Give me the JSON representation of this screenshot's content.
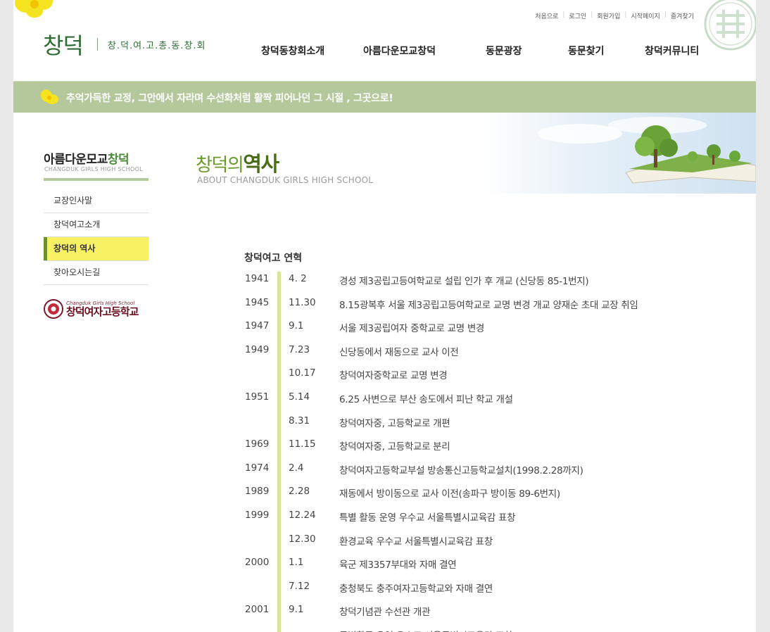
{
  "utility": [
    "처음으로",
    "로그인",
    "회원가입",
    "시작페이지",
    "즐겨찾기"
  ],
  "logo": {
    "main": "창덕",
    "sub": "창.덕.여.고.총.동.창.회"
  },
  "gnb": [
    "창덕동창회소개",
    "아름다운모교창덕",
    "동문광장",
    "동문찾기",
    "창덕커뮤니티"
  ],
  "slogan": "추억가득한 교정, 그안에서 자라며 수선화처럼 활짝 피어나던 그 시절 , 그곳으로!",
  "sidebar": {
    "title_a": "아름다운모교",
    "title_b": "창덕",
    "subtitle": "CHANGDUK GIRLS HIGH SCHOOL",
    "items": [
      {
        "label": "교장인사말",
        "active": false
      },
      {
        "label": "창덕여고소개",
        "active": false
      },
      {
        "label": "창덕의 역사",
        "active": true
      },
      {
        "label": "찾아오시는길",
        "active": false
      }
    ],
    "school_logo": {
      "en": "Changduk Girls High School",
      "ko": "창덕여자고등학교"
    }
  },
  "page": {
    "title_a": "창덕의",
    "title_b": "역사",
    "subtitle": "ABOUT CHANGDUK GIRLS HIGH SCHOOL"
  },
  "history": {
    "title": "창덕여고 연혁",
    "rows": [
      {
        "year": "1941",
        "date": "4. 2",
        "text": "경성 제3공립고등여학교로 설립 인가 후 개교 (신당동 85-1번지)"
      },
      {
        "year": "1945",
        "date": "11.30",
        "text": "8.15광복후 서울 제3공립고등여학교로 교명 변경 개교 양재순 초대 교장 취임"
      },
      {
        "year": "1947",
        "date": "9.1",
        "text": "서울 제3공립여자 중학교로 교명 변경"
      },
      {
        "year": "1949",
        "date": "7.23",
        "text": "신당동에서 재동으로 교사 이전"
      },
      {
        "year": "",
        "date": "10.17",
        "text": "창덕여자중학교로 교명 변경"
      },
      {
        "year": "1951",
        "date": "5.14",
        "text": "6.25 사변으로 부산 송도에서 피난 학교 개설"
      },
      {
        "year": "",
        "date": "8.31",
        "text": "창덕여자중, 고등학교로 개편"
      },
      {
        "year": "1969",
        "date": "11.15",
        "text": "창덕여자중, 고등학교로 분리"
      },
      {
        "year": "1974",
        "date": "2.4",
        "text": "창덕여자고등학교부설 방송통신고등학교설치(1998.2.28까지)"
      },
      {
        "year": "1989",
        "date": "2.28",
        "text": "재동에서 방이동으로 교사 이전(송파구 방이동 89-6번지)"
      },
      {
        "year": "1999",
        "date": "12.24",
        "text": "특별 활동 운영 우수교 서울특별시교육감 표창"
      },
      {
        "year": "",
        "date": "12.30",
        "text": "환경교육 우수교 서울특별시교육감 표창"
      },
      {
        "year": "2000",
        "date": "1.1",
        "text": "육군 제3357부대와 자매 결연"
      },
      {
        "year": "",
        "date": "7.12",
        "text": "충청북도 충주여자고등학교와 자매 결연"
      },
      {
        "year": "2001",
        "date": "9.1",
        "text": "창덕기념관 수선관 개관"
      },
      {
        "year": "",
        "date": "",
        "text": "특별활동 운영 우수교 서울특별시교육감 표창"
      }
    ]
  },
  "colors": {
    "band": "#b4c89c",
    "brand_green": "#2e6b37",
    "active": "#f7f163",
    "timeline": "#d7e69a"
  }
}
